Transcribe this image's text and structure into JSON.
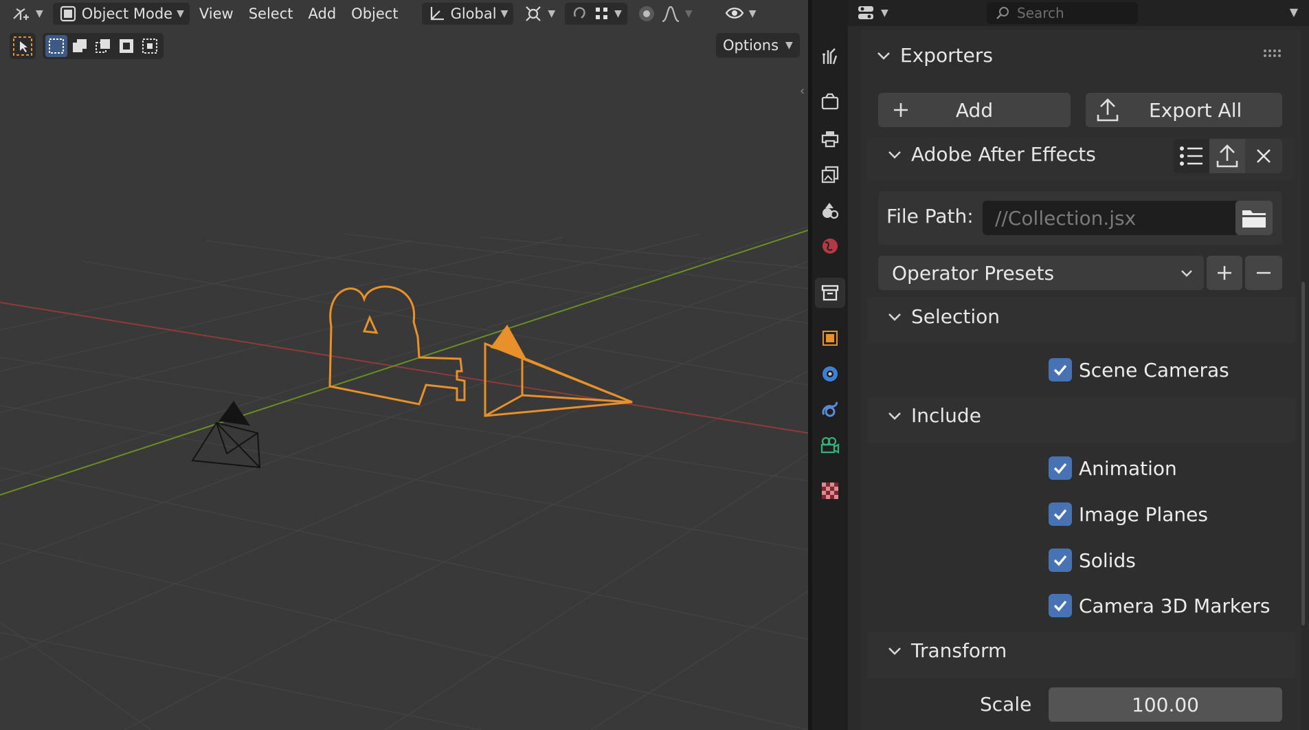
{
  "viewport": {
    "header": {
      "mode_label": "Object Mode",
      "menus": [
        "View",
        "Select",
        "Add",
        "Object"
      ],
      "transform_orientation": "Global"
    },
    "options_label": "Options"
  },
  "properties": {
    "search_placeholder": "Search",
    "exporters": {
      "title": "Exporters",
      "add_label": "Add",
      "export_all_label": "Export All"
    },
    "exporter_item": {
      "title": "Adobe After Effects",
      "file_path_label": "File Path:",
      "file_path_value": "//Collection.jsx",
      "operator_presets_label": "Operator Presets"
    },
    "selection": {
      "title": "Selection",
      "items": [
        {
          "label": "Scene Cameras",
          "checked": true
        }
      ]
    },
    "include": {
      "title": "Include",
      "items": [
        {
          "label": "Animation",
          "checked": true
        },
        {
          "label": "Image Planes",
          "checked": true
        },
        {
          "label": "Solids",
          "checked": true
        },
        {
          "label": "Camera 3D Markers",
          "checked": true
        }
      ]
    },
    "transform": {
      "title": "Transform",
      "scale_label": "Scale",
      "scale_value": "100.00"
    }
  },
  "colors": {
    "accent": "#4772b3",
    "selected_object": "#e8912a",
    "x_axis": "#9c3b3b",
    "y_axis": "#6b8e23"
  }
}
